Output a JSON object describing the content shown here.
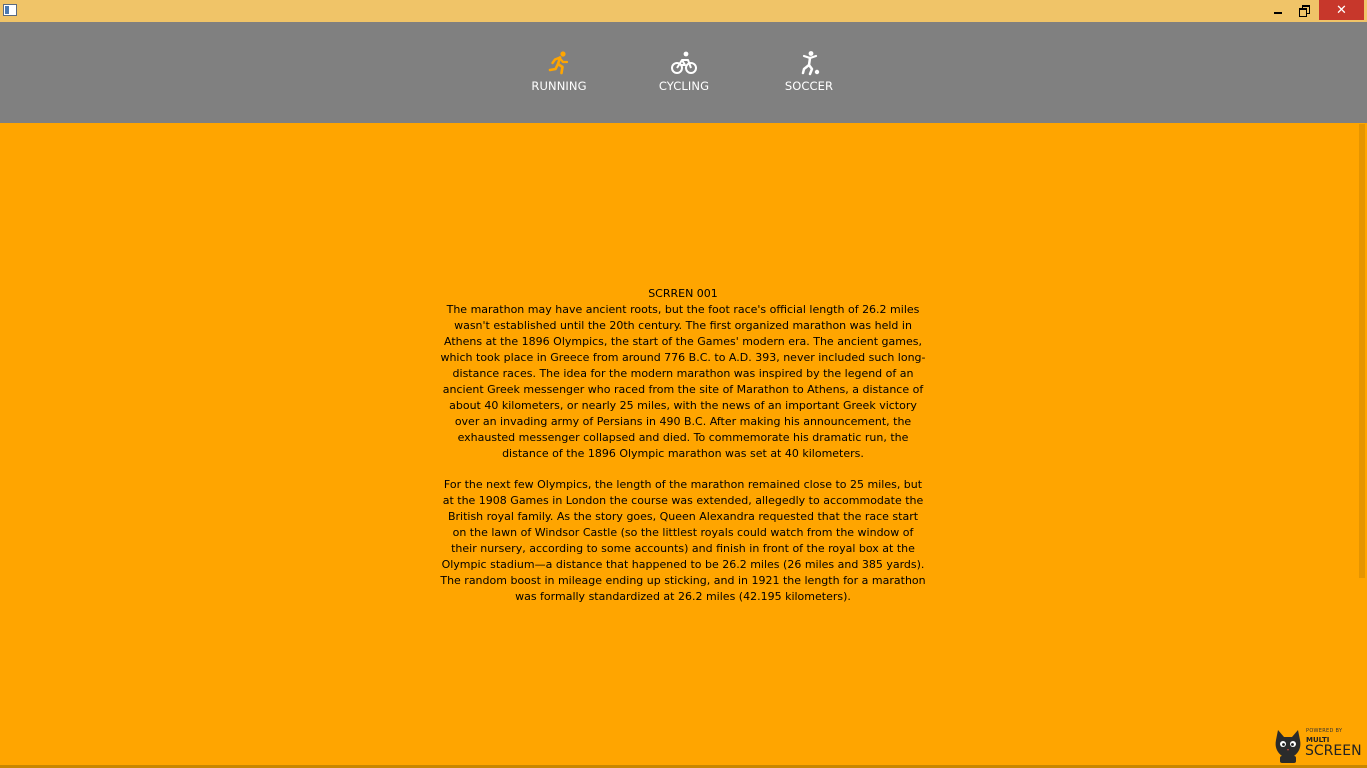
{
  "window": {
    "minimize_icon": "minimize-icon",
    "maximize_icon": "restore-icon",
    "close_icon": "close-icon",
    "close_glyph": "✕"
  },
  "nav": {
    "items": [
      {
        "label": "RUNNING",
        "icon": "running-icon",
        "active": true
      },
      {
        "label": "CYCLING",
        "icon": "cycling-icon",
        "active": false
      },
      {
        "label": "SOCCER",
        "icon": "soccer-icon",
        "active": false
      }
    ]
  },
  "content": {
    "heading": "SCRREN 001",
    "paragraphs": [
      "The marathon may have ancient roots, but the foot race's official length of 26.2 miles wasn't established until the 20th century. The first organized marathon was held in Athens at the 1896 Olympics, the start of the Games' modern era. The ancient games, which took place in Greece from around 776 B.C. to A.D. 393, never included such long-distance races. The idea for the modern marathon was inspired by the legend of an ancient Greek messenger who raced from the site of Marathon to Athens, a distance of about 40 kilometers, or nearly 25 miles, with the news of an important Greek victory over an invading army of Persians in 490 B.C. After making his announcement, the exhausted messenger collapsed and died. To commemorate his dramatic run, the distance of the 1896 Olympic marathon was set at 40 kilometers.",
      "For the next few Olympics, the length of the marathon remained close to 25 miles, but at the 1908 Games in London the course was extended, allegedly to accommodate the British royal family. As the story goes, Queen Alexandra requested that the race start on the lawn of Windsor Castle (so the littlest royals could watch from the window of their nursery, according to some accounts) and finish in front of the royal box at the Olympic stadium—a distance that happened to be 26.2 miles (26 miles and 385 yards). The random boost in mileage ending up sticking, and in 1921 the length for a marathon was formally standardized at 26.2 miles (42.195 kilometers)."
    ]
  },
  "logo": {
    "small_text": "POWERED BY",
    "line1": "MULTI",
    "line2": "SCREEN"
  },
  "colors": {
    "background": "#FFA500",
    "navbar": "#808080",
    "titlebar": "#F0C468",
    "active_icon": "#FFA500",
    "close_button": "#C7372B"
  }
}
